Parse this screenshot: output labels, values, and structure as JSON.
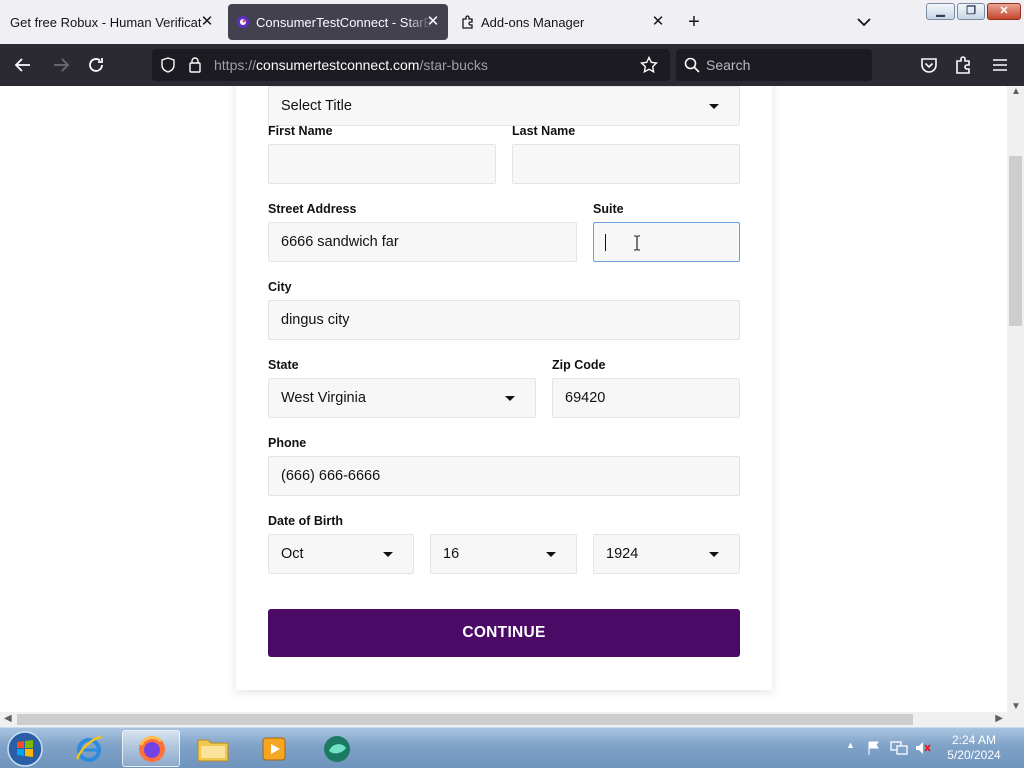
{
  "browser": {
    "tabs": [
      {
        "title": "Get free Robux - Human Verification",
        "active": false
      },
      {
        "title": "ConsumerTestConnect - StarBucks",
        "active": true
      },
      {
        "title": "Add-ons Manager",
        "active": false
      }
    ],
    "url_scheme": "https://",
    "url_host": "consumertestconnect.com",
    "url_path": "/star-bucks",
    "search_placeholder": "Search"
  },
  "form": {
    "title_select": "Select Title",
    "first_name_label": "First Name",
    "first_name_value": "",
    "last_name_label": "Last Name",
    "last_name_value": "",
    "street_label": "Street Address",
    "street_value": "6666 sandwich far",
    "suite_label": "Suite",
    "suite_value": "",
    "city_label": "City",
    "city_value": "dingus city",
    "state_label": "State",
    "state_value": "West Virginia",
    "zip_label": "Zip Code",
    "zip_value": "69420",
    "phone_label": "Phone",
    "phone_value": "(666) 666-6666",
    "dob_label": "Date of Birth",
    "dob_month": "Oct",
    "dob_day": "16",
    "dob_year": "1924",
    "continue_label": "CONTINUE"
  },
  "taskbar": {
    "time": "2:24 AM",
    "date": "5/20/2024"
  },
  "colors": {
    "continue_button": "#4a0a66",
    "browser_toolbar": "#2b2a33",
    "focus_border": "#6ba0df"
  }
}
